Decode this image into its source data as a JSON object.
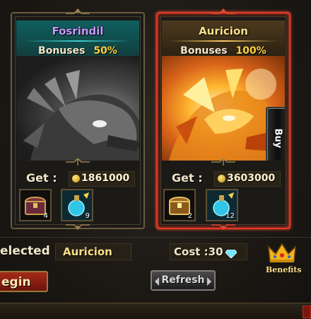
{
  "cards": [
    {
      "name": "Fosrindil",
      "bonuses_label": "Bonuses",
      "bonuses_value": "50%",
      "get_label": "Get :",
      "get_value": "1861000",
      "items": [
        {
          "icon": "treasure-chest-icon",
          "qty": "4"
        },
        {
          "icon": "blue-potion-icon",
          "qty": "9"
        }
      ]
    },
    {
      "name": "Auricion",
      "bonuses_label": "Bonuses",
      "bonuses_value": "100%",
      "get_label": "Get :",
      "get_value": "3603000",
      "buy_label": "Buy",
      "items": [
        {
          "icon": "treasure-chest-icon",
          "qty": "2"
        },
        {
          "icon": "blue-potion-icon",
          "qty": "12"
        }
      ]
    }
  ],
  "selected": {
    "label": "elected :",
    "value": "Auricion"
  },
  "cost": {
    "label": "Cost :30",
    "currency_icon": "diamond-icon"
  },
  "benefits_label": "Benefits",
  "begin_label": "egin",
  "refresh_label": "Refresh",
  "colors": {
    "selected_border": "#e23a2a",
    "gold_text": "#ffe08a",
    "purple_name": "#c79bff"
  }
}
